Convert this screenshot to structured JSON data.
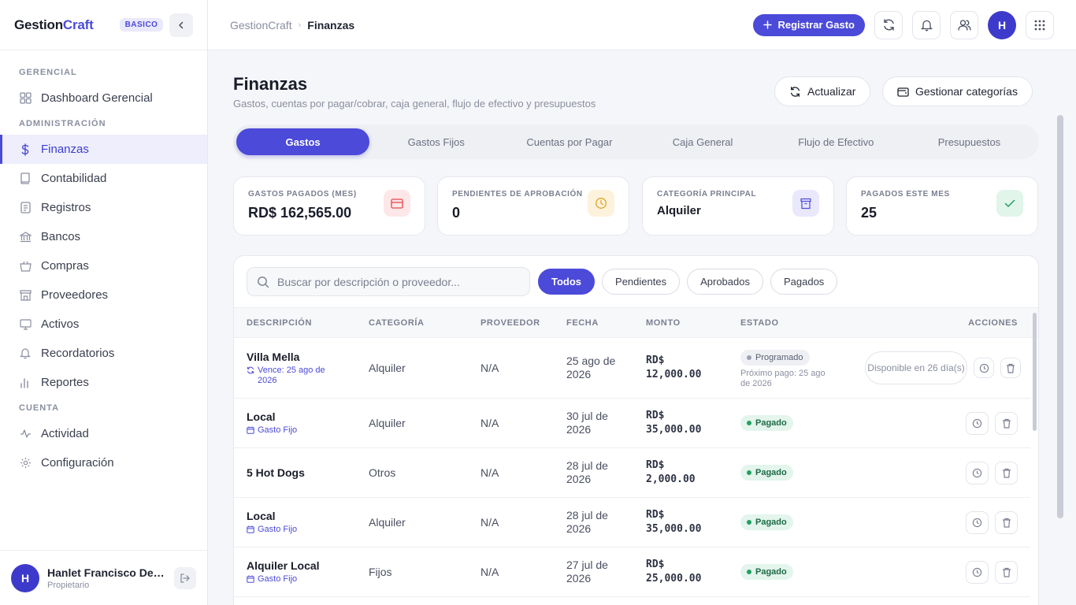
{
  "brand": {
    "name_part1": "Gestion",
    "name_part2": "Craft",
    "plan": "BASICO"
  },
  "sidebar": {
    "sections": [
      {
        "title": "GERENCIAL",
        "items": [
          {
            "label": "Dashboard Gerencial",
            "icon": "grid-icon"
          }
        ]
      },
      {
        "title": "ADMINISTRACIÓN",
        "items": [
          {
            "label": "Finanzas",
            "icon": "dollar-icon",
            "active": true
          },
          {
            "label": "Contabilidad",
            "icon": "book-icon"
          },
          {
            "label": "Registros",
            "icon": "file-icon"
          },
          {
            "label": "Bancos",
            "icon": "bank-icon"
          },
          {
            "label": "Compras",
            "icon": "basket-icon"
          },
          {
            "label": "Proveedores",
            "icon": "store-icon"
          },
          {
            "label": "Activos",
            "icon": "monitor-icon"
          },
          {
            "label": "Recordatorios",
            "icon": "bell-icon"
          },
          {
            "label": "Reportes",
            "icon": "bar-chart-icon"
          }
        ]
      },
      {
        "title": "CUENTA",
        "items": [
          {
            "label": "Actividad",
            "icon": "activity-icon"
          },
          {
            "label": "Configuración",
            "icon": "gear-icon"
          }
        ]
      }
    ],
    "user": {
      "initial": "H",
      "name": "Hanlet Francisco De L...",
      "role": "Propietario"
    }
  },
  "topbar": {
    "breadcrumb_root": "GestionCraft",
    "breadcrumb_current": "Finanzas",
    "primary_action": "Registrar Gasto",
    "avatar_initial": "H"
  },
  "page": {
    "title": "Finanzas",
    "subtitle": "Gastos, cuentas por pagar/cobrar, caja general, flujo de efectivo y presupuestos",
    "refresh_label": "Actualizar",
    "categories_label": "Gestionar categorías"
  },
  "tabs": [
    "Gastos",
    "Gastos Fijos",
    "Cuentas por Pagar",
    "Caja General",
    "Flujo de Efectivo",
    "Presupuestos"
  ],
  "stats": [
    {
      "label": "GASTOS PAGADOS (MES)",
      "value": "RD$ 162,565.00",
      "icon": "card-icon",
      "color": "#e5484d"
    },
    {
      "label": "PENDIENTES DE APROBACIÓN",
      "value": "0",
      "icon": "clock-icon",
      "color": "#e0a526"
    },
    {
      "label": "CATEGORÍA PRINCIPAL",
      "value": "Alquiler",
      "icon": "archive-icon",
      "color": "#4b4ad9"
    },
    {
      "label": "PAGADOS ESTE MES",
      "value": "25",
      "icon": "check-icon",
      "color": "#22a060"
    }
  ],
  "filters": {
    "search_placeholder": "Buscar por descripción o proveedor...",
    "chips": [
      "Todos",
      "Pendientes",
      "Aprobados",
      "Pagados"
    ]
  },
  "table": {
    "columns": [
      "DESCRIPCIÓN",
      "CATEGORÍA",
      "PROVEEDOR",
      "FECHA",
      "MONTO",
      "ESTADO",
      "ACCIONES"
    ],
    "rows": [
      {
        "title": "Villa Mella",
        "sub": "Vence: 25 ago de 2026",
        "sub_icon": "repeat-icon",
        "category": "Alquiler",
        "provider": "N/A",
        "date": "25 ago de 2026",
        "amount_l1": "RD$",
        "amount_l2": "12,000.00",
        "status": "Programado",
        "status_sub": "Próximo pago: 25 ago de 2026",
        "action_note": "Disponible en 26 día(s)"
      },
      {
        "title": "Local",
        "sub": "Gasto Fijo",
        "sub_icon": "calendar-icon",
        "category": "Alquiler",
        "provider": "N/A",
        "date": "30 jul de 2026",
        "amount_l1": "RD$",
        "amount_l2": "35,000.00",
        "status": "Pagado"
      },
      {
        "title": "5 Hot Dogs",
        "sub": "",
        "category": "Otros",
        "provider": "N/A",
        "date": "28 jul de 2026",
        "amount_l1": "RD$",
        "amount_l2": "2,000.00",
        "status": "Pagado"
      },
      {
        "title": "Local",
        "sub": "Gasto Fijo",
        "sub_icon": "calendar-icon",
        "category": "Alquiler",
        "provider": "N/A",
        "date": "28 jul de 2026",
        "amount_l1": "RD$",
        "amount_l2": "35,000.00",
        "status": "Pagado"
      },
      {
        "title": "Alquiler Local",
        "sub": "Gasto Fijo",
        "sub_icon": "calendar-icon",
        "category": "Fijos",
        "provider": "N/A",
        "date": "27 jul de 2026",
        "amount_l1": "RD$",
        "amount_l2": "25,000.00",
        "status": "Pagado"
      }
    ]
  }
}
